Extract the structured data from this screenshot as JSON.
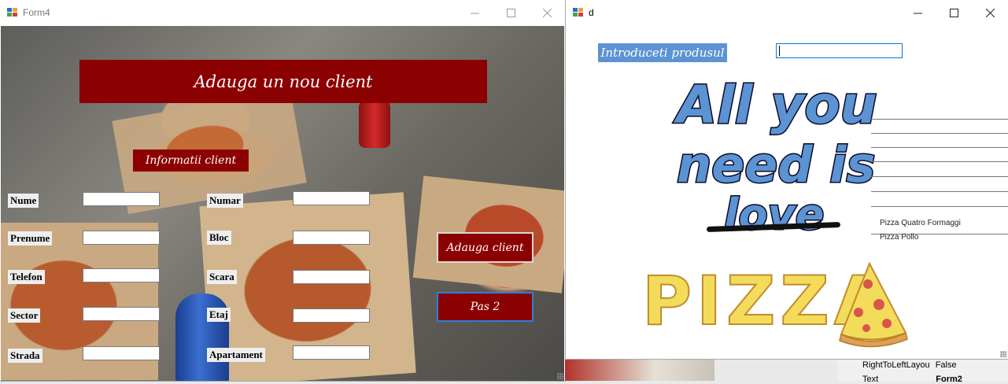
{
  "form4": {
    "title": "Form4",
    "banner": "Adauga un nou client",
    "section_label": "Informatii client",
    "fields_left": [
      {
        "label": "Nume",
        "value": ""
      },
      {
        "label": "Prenume",
        "value": ""
      },
      {
        "label": "Telefon",
        "value": ""
      },
      {
        "label": "Sector",
        "value": ""
      },
      {
        "label": "Strada",
        "value": ""
      }
    ],
    "fields_right": [
      {
        "label": "Numar",
        "value": ""
      },
      {
        "label": "Bloc",
        "value": ""
      },
      {
        "label": "Scara",
        "value": ""
      },
      {
        "label": "Etaj",
        "value": ""
      },
      {
        "label": "Apartament",
        "value": ""
      }
    ],
    "add_button": "Adauga client",
    "next_button": "Pas 2"
  },
  "form_d": {
    "title": "d",
    "product_label": "Introduceti produsul",
    "product_input_value": "",
    "art_line1": "All you",
    "art_line2": "need is",
    "art_line3": "love",
    "art_pizza": "PIZZA",
    "list_items": [
      "Pizza Quatro Formaggi",
      "Pizza Pollo"
    ]
  },
  "properties": {
    "rows": [
      {
        "name": "RightToLeftLayout",
        "display_name": "RightToLeftLayou",
        "value": "False"
      },
      {
        "name": "Text",
        "display_name": "Text",
        "value": "Form2"
      }
    ]
  },
  "colors": {
    "accent_red": "#8b0000",
    "accent_blue": "#5b93d3"
  }
}
